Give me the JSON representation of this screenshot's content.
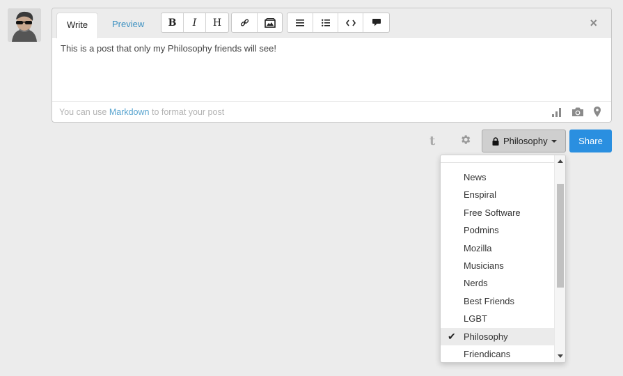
{
  "editor": {
    "tabs": {
      "write": "Write",
      "preview": "Preview"
    },
    "toolbar": {
      "bold": "B",
      "italic": "I",
      "heading": "H"
    },
    "body_text": "This is a post that only my Philosophy friends will see!",
    "hint_prefix": "You can use ",
    "hint_link": "Markdown",
    "hint_suffix": " to format your post",
    "close_label": "×"
  },
  "actions": {
    "tumblr_label": "t",
    "aspect_label": "Philosophy",
    "share_label": "Share"
  },
  "dropdown": {
    "items": [
      {
        "label": "News"
      },
      {
        "label": "Enspiral"
      },
      {
        "label": "Free Software"
      },
      {
        "label": "Podmins"
      },
      {
        "label": "Mozilla"
      },
      {
        "label": "Musicians"
      },
      {
        "label": "Nerds"
      },
      {
        "label": "Best Friends"
      },
      {
        "label": "LGBT"
      },
      {
        "label": "Philosophy",
        "selected": true
      },
      {
        "label": "Friendicans"
      }
    ],
    "check_glyph": "✔"
  },
  "colors": {
    "accent": "#2a8fe0",
    "link": "#5aa5d0",
    "tab_link": "#3a8fc0",
    "background": "#ececec"
  }
}
